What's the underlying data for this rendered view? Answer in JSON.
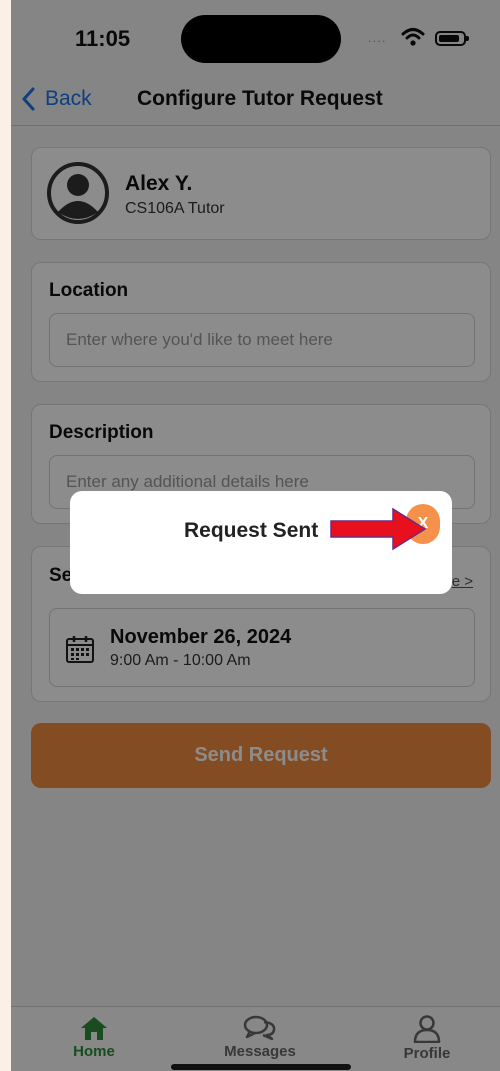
{
  "status_bar": {
    "time": "11:05",
    "signal": "...."
  },
  "navbar": {
    "back_label": "Back",
    "title": "Configure Tutor Request"
  },
  "tutor": {
    "name": "Alex Y.",
    "subtitle": "CS106A Tutor"
  },
  "location": {
    "label": "Location",
    "placeholder": "Enter where you'd like to meet here",
    "value": ""
  },
  "description": {
    "label": "Description",
    "placeholder": "Enter any additional details here",
    "value": ""
  },
  "schedule": {
    "label": "Se",
    "change_link": "e >",
    "date": "November 26, 2024",
    "time": "9:00 Am - 10:00 Am"
  },
  "send_button": {
    "label": "Send Request"
  },
  "tabs": [
    {
      "label": "Home",
      "icon": "home-icon",
      "active": true
    },
    {
      "label": "Messages",
      "icon": "chat-bubbles-icon",
      "active": false
    },
    {
      "label": "Profile",
      "icon": "person-icon",
      "active": false
    }
  ],
  "modal": {
    "title": "Request Sent",
    "close_label": "X"
  },
  "colors": {
    "accent_orange": "#f08a3e",
    "link_blue": "#1a73e8",
    "active_tab_green": "#2e8b3a",
    "annotation_arrow": "#e8101c"
  }
}
